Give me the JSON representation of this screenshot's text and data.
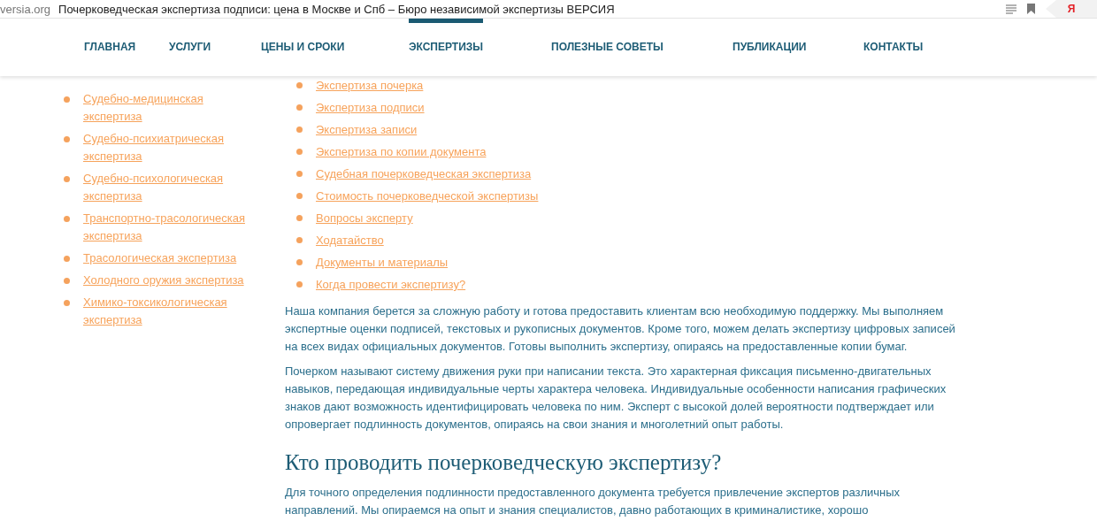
{
  "browser": {
    "domain": "versia.org",
    "title": "Почерковедческая экспертиза подписи: цена в Москве и Спб – Бюро независимой экспертизы ВЕРСИЯ",
    "logo": "Я"
  },
  "nav": [
    {
      "label": "ГЛАВНАЯ",
      "selected": false
    },
    {
      "label": "УСЛУГИ",
      "selected": false
    },
    {
      "label": "ЦЕНЫ И СРОКИ",
      "selected": false
    },
    {
      "label": "ЭКСПЕРТИЗЫ",
      "selected": true
    },
    {
      "label": "ПОЛЕЗНЫЕ СОВЕТЫ",
      "selected": false
    },
    {
      "label": "ПУБЛИКАЦИИ",
      "selected": false
    },
    {
      "label": "КОНТАКТЫ",
      "selected": false
    }
  ],
  "sidebar": {
    "items": [
      "Судебно-медицинская экспертиза",
      "Судебно-психиатрическая экспертиза",
      "Судебно-психологическая экспертиза",
      "Транспортно-трасологическая экспертиза",
      "Трасологическая экспертиза",
      "Холодного оружия экспертиза",
      "Химико-токсикологическая экспертиза"
    ]
  },
  "main": {
    "links": [
      "Экспертиза почерка",
      "Экспертиза подписи",
      "Экспертиза записи",
      "Экспертиза по копии документа",
      "Судебная почерковедческая экспертиза",
      "Стоимость почерковедческой экспертизы",
      "Вопросы эксперту",
      "Ходатайство",
      "Документы и материалы",
      "Когда провести экспертизу?"
    ],
    "blocks": [
      {
        "kind": "paragraph",
        "text": "Наша компания берется за сложную работу и готова предоставить клиентам всю необходимую поддержку. Мы выполняем экспертные оценки подписей, текстовых и рукописных документов. Кроме того, можем делать экспертизу цифровых записей на всех видах официальных документов. Готовы выполнить экспертизу, опираясь на предоставленные копии бумаг."
      },
      {
        "kind": "paragraph",
        "text": "Почерком называют систему движения руки при написании текста. Это характерная фиксация письменно-двигательных навыков, передающая индивидуальные черты характера человека. Индивидуальные особенности написания графических знаков дают возможность идентифицировать человека по ним. Эксперт с высокой долей вероятности подтверждает или опровергает подлинность документов, опираясь на свои знания и многолетний опыт работы."
      },
      {
        "kind": "heading",
        "text": "Кто проводить почерковедческую экспертизу?"
      },
      {
        "kind": "paragraph",
        "text": "Для точного определения подлинности предоставленного документа требуется привлечение экспертов различных направлений. Мы опираемся на опыт и знания специалистов, давно работающих в криминалистике, хорошо"
      }
    ]
  }
}
